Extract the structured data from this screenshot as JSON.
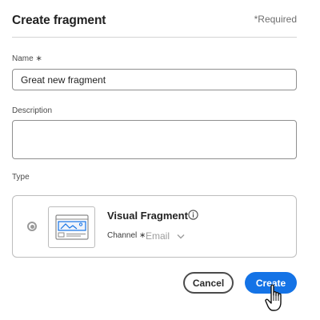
{
  "dialog": {
    "title": "Create fragment",
    "required_note": "*Required"
  },
  "form": {
    "name": {
      "label": "Name ∗",
      "value": "Great new fragment"
    },
    "description": {
      "label": "Description",
      "value": ""
    },
    "type": {
      "label": "Type"
    }
  },
  "type_option": {
    "title": "Visual Fragment",
    "selected": true,
    "channel_label": "Channel ∗",
    "channel_value": "Email",
    "icons": {
      "info": "info-icon",
      "chevron": "chevron-down-icon",
      "thumbnail": "visual-fragment-thumbnail-icon"
    }
  },
  "actions": {
    "cancel_label": "Cancel",
    "create_label": "Create"
  },
  "colors": {
    "primary": "#1473e6",
    "border": "#8f8f8f",
    "text": "#2c2c2c"
  },
  "cursor": "hand-pointer-cursor"
}
